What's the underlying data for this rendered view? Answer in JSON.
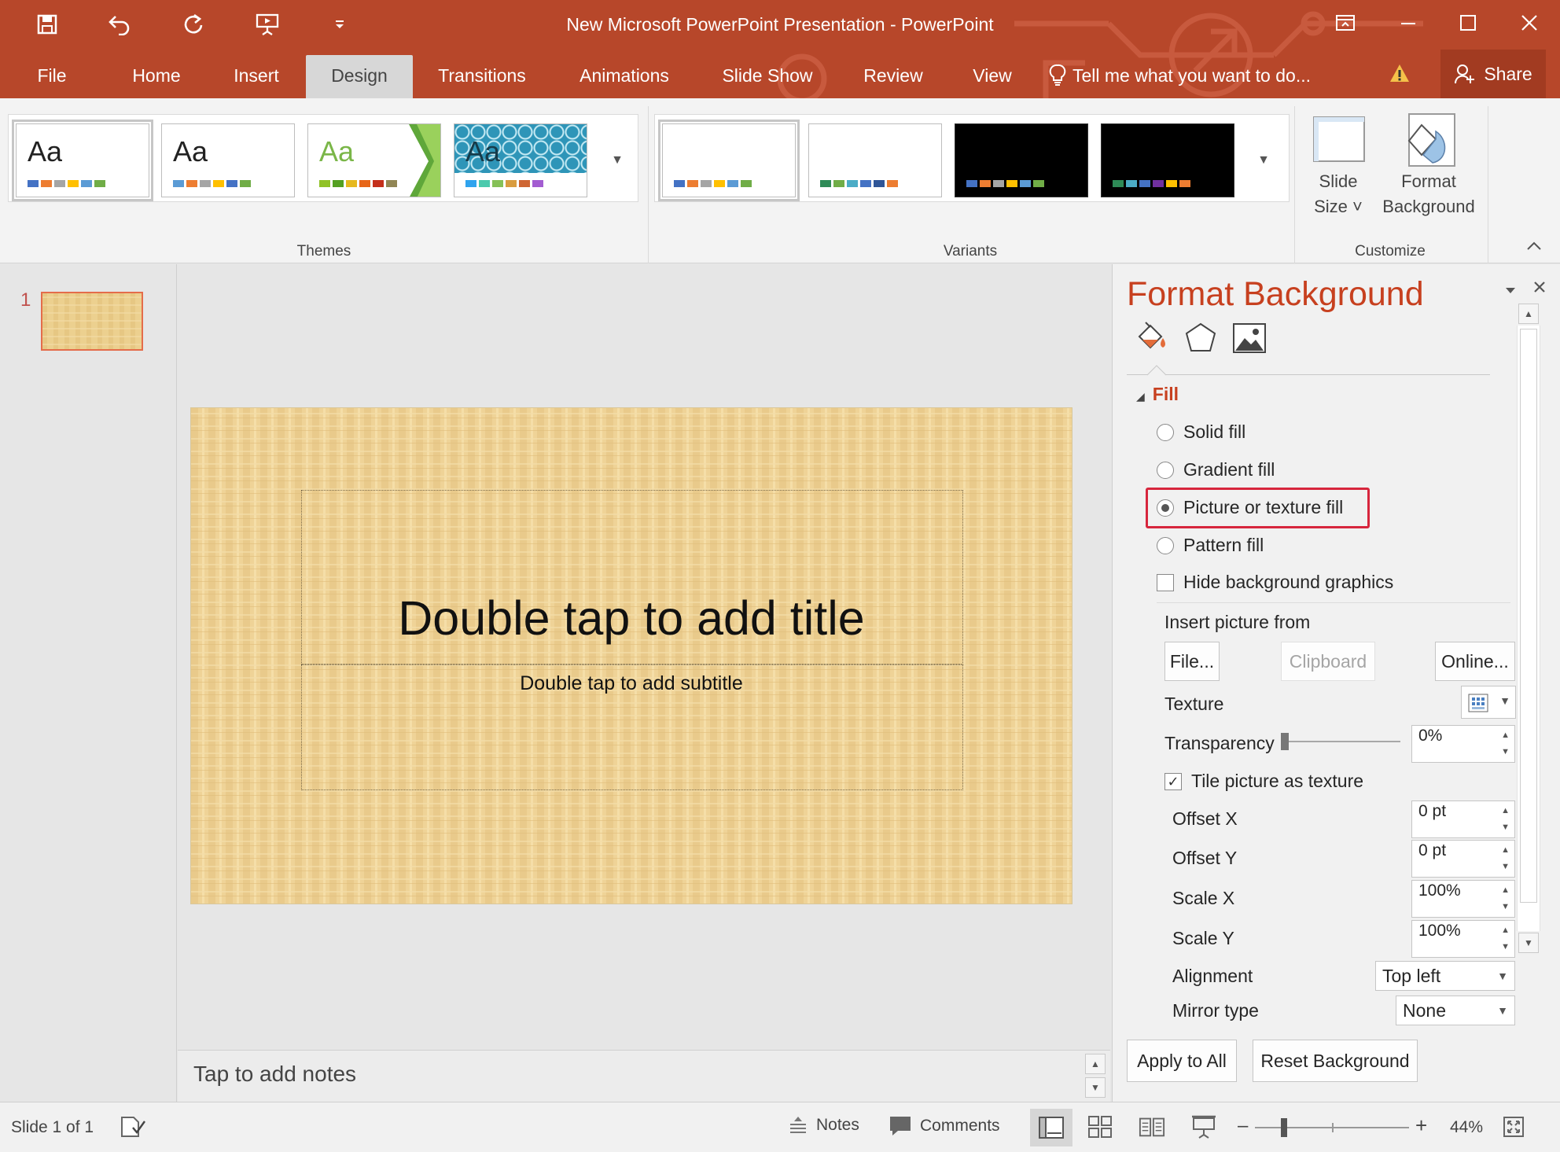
{
  "window": {
    "title": "New Microsoft PowerPoint Presentation - PowerPoint"
  },
  "ribbon_tabs": [
    "File",
    "Home",
    "Insert",
    "Design",
    "Transitions",
    "Animations",
    "Slide Show",
    "Review",
    "View"
  ],
  "active_tab": "Design",
  "tell_me": "Tell me what you want to do...",
  "share_label": "Share",
  "ribbon": {
    "themes_label": "Themes",
    "variants_label": "Variants",
    "customize_label": "Customize",
    "theme_text": "Aa",
    "slide_size": [
      "Slide",
      "Size ˅"
    ],
    "format_background": [
      "Format",
      "Background"
    ]
  },
  "colors": {
    "accent": "#b7472a",
    "pane_title": "#c7401f",
    "highlight": "#d7263d"
  },
  "slide": {
    "number": "1",
    "title_placeholder": "Double tap to add title",
    "subtitle_placeholder": "Double tap to add subtitle",
    "notes_placeholder": "Tap to add notes"
  },
  "pane": {
    "title": "Format Background",
    "section": "Fill",
    "fill_options": [
      {
        "label": "Solid fill",
        "selected": false
      },
      {
        "label": "Gradient fill",
        "selected": false
      },
      {
        "label": "Picture or texture fill",
        "selected": true
      },
      {
        "label": "Pattern fill",
        "selected": false
      }
    ],
    "hide_graphics": "Hide background graphics",
    "insert_from": "Insert picture from",
    "file_btn": "File...",
    "clipboard_btn": "Clipboard",
    "online_btn": "Online...",
    "texture": "Texture",
    "transparency": "Transparency",
    "transparency_value": "0%",
    "tile_label": "Tile picture as texture",
    "tile_checked": true,
    "offset_x_label": "Offset X",
    "offset_x": "0 pt",
    "offset_y_label": "Offset Y",
    "offset_y": "0 pt",
    "scale_x_label": "Scale X",
    "scale_x": "100%",
    "scale_y_label": "Scale Y",
    "scale_y": "100%",
    "alignment_label": "Alignment",
    "alignment": "Top left",
    "mirror_label": "Mirror type",
    "mirror": "None",
    "apply_all": "Apply to All",
    "reset": "Reset Background"
  },
  "status": {
    "slide_info": "Slide 1 of 1",
    "notes": "Notes",
    "comments": "Comments",
    "zoom": "44%",
    "zoom_fraction": 0.44
  }
}
